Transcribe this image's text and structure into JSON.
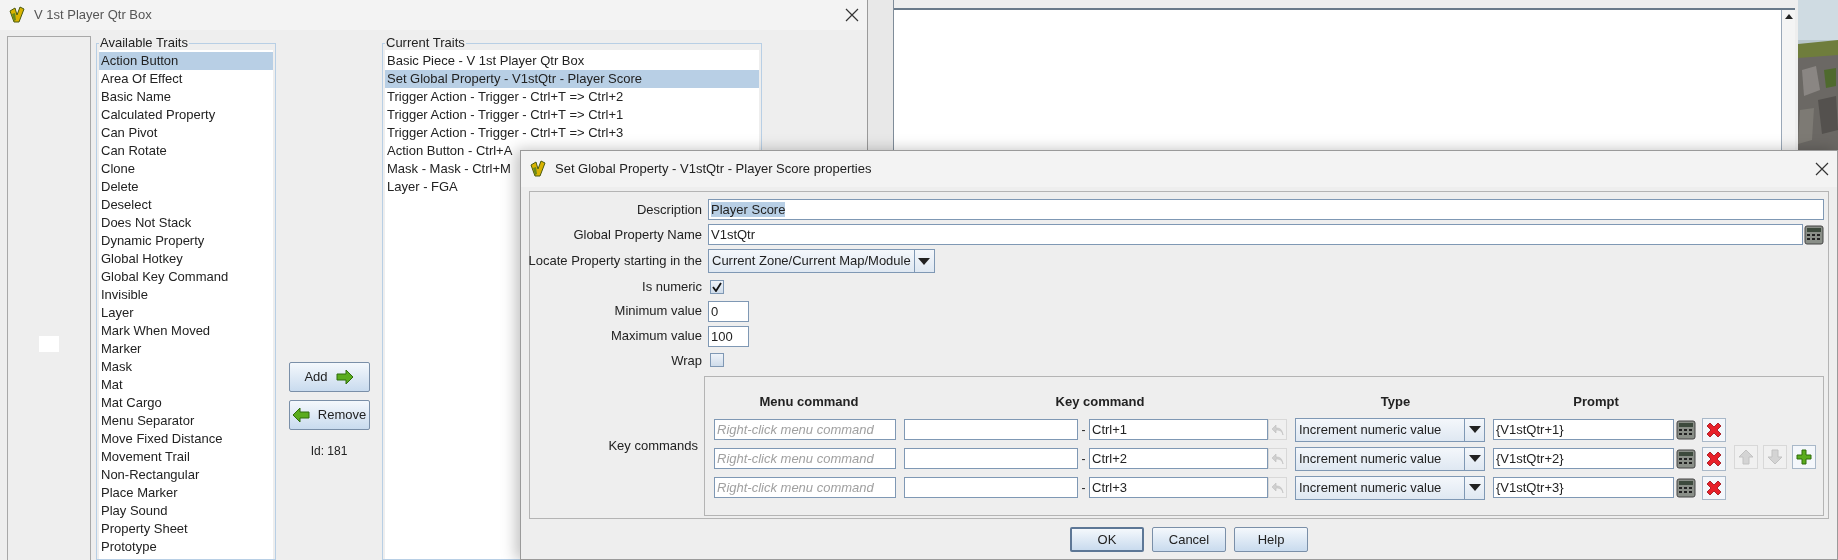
{
  "main_window": {
    "title": "V 1st Player Qtr Box"
  },
  "available_traits": {
    "title": "Available Traits",
    "items": [
      {
        "label": "Action Button",
        "selected": true
      },
      {
        "label": "Area Of Effect",
        "selected": false
      },
      {
        "label": "Basic Name",
        "selected": false
      },
      {
        "label": "Calculated Property",
        "selected": false
      },
      {
        "label": "Can Pivot",
        "selected": false
      },
      {
        "label": "Can Rotate",
        "selected": false
      },
      {
        "label": "Clone",
        "selected": false
      },
      {
        "label": "Delete",
        "selected": false
      },
      {
        "label": "Deselect",
        "selected": false
      },
      {
        "label": "Does Not Stack",
        "selected": false
      },
      {
        "label": "Dynamic Property",
        "selected": false
      },
      {
        "label": "Global Hotkey",
        "selected": false
      },
      {
        "label": "Global Key Command",
        "selected": false
      },
      {
        "label": "Invisible",
        "selected": false
      },
      {
        "label": "Layer",
        "selected": false
      },
      {
        "label": "Mark When Moved",
        "selected": false
      },
      {
        "label": "Marker",
        "selected": false
      },
      {
        "label": "Mask",
        "selected": false
      },
      {
        "label": "Mat",
        "selected": false
      },
      {
        "label": "Mat Cargo",
        "selected": false
      },
      {
        "label": "Menu Separator",
        "selected": false
      },
      {
        "label": "Move Fixed Distance",
        "selected": false
      },
      {
        "label": "Movement Trail",
        "selected": false
      },
      {
        "label": "Non-Rectangular",
        "selected": false
      },
      {
        "label": "Place Marker",
        "selected": false
      },
      {
        "label": "Play Sound",
        "selected": false
      },
      {
        "label": "Property Sheet",
        "selected": false
      },
      {
        "label": "Prototype",
        "selected": false
      }
    ]
  },
  "trait_buttons": [
    {
      "kind": "add",
      "label": "Add"
    },
    {
      "kind": "remove",
      "label": "Remove"
    }
  ],
  "id_label": "Id: 181",
  "current_traits": {
    "title": "Current Traits",
    "items": [
      {
        "label": "Basic Piece - V 1st Player Qtr Box",
        "selected": false
      },
      {
        "label": "Set Global Property - V1stQtr - Player Score",
        "selected": true
      },
      {
        "label": "Trigger Action - Trigger - Ctrl+T => Ctrl+2",
        "selected": false
      },
      {
        "label": "Trigger Action - Trigger - Ctrl+T => Ctrl+1",
        "selected": false
      },
      {
        "label": "Trigger Action - Trigger - Ctrl+T => Ctrl+3",
        "selected": false
      },
      {
        "label": "Action Button - Ctrl+A",
        "selected": false
      },
      {
        "label": "Mask - Mask - Ctrl+M",
        "selected": false
      },
      {
        "label": "Layer - FGA",
        "selected": false
      }
    ]
  },
  "dialog": {
    "title": "Set Global Property - V1stQtr - Player Score properties",
    "form": [
      {
        "kind": "text",
        "label": "Description",
        "value": "Player Score",
        "text_selected": true,
        "calculator": false
      },
      {
        "kind": "text",
        "label": "Global Property Name",
        "value": "V1stQtr",
        "text_selected": false,
        "calculator": true
      },
      {
        "kind": "combo",
        "label": "Locate Property starting in the",
        "value": "Current Zone/Current Map/Module"
      },
      {
        "kind": "checkbox",
        "label": "Is numeric",
        "checked": true
      },
      {
        "kind": "short_text",
        "label": "Minimum value",
        "value": "0"
      },
      {
        "kind": "short_text",
        "label": "Maximum value",
        "value": "100"
      },
      {
        "kind": "checkbox",
        "label": "Wrap",
        "checked": false
      }
    ],
    "key_commands": {
      "label": "Key commands",
      "columns": [
        "Menu command",
        "Key command",
        "Type",
        "Prompt"
      ],
      "rows": [
        {
          "menu_placeholder": "Right-click menu command",
          "separator": "-",
          "keystroke": "Ctrl+1",
          "type": "Increment numeric value",
          "prompt": "{V1stQtr+1}"
        },
        {
          "menu_placeholder": "Right-click menu command",
          "separator": "-",
          "keystroke": "Ctrl+2",
          "type": "Increment numeric value",
          "prompt": "{V1stQtr+2}"
        },
        {
          "menu_placeholder": "Right-click menu command",
          "separator": "-",
          "keystroke": "Ctrl+3",
          "type": "Increment numeric value",
          "prompt": "{V1stQtr+3}"
        }
      ],
      "side_buttons": [
        {
          "kind": "up",
          "disabled": true
        },
        {
          "kind": "down",
          "disabled": true
        },
        {
          "kind": "add",
          "disabled": false
        }
      ]
    },
    "buttons": [
      {
        "label": "OK",
        "focused": true
      },
      {
        "label": "Cancel",
        "focused": false
      },
      {
        "label": "Help",
        "focused": false
      }
    ]
  }
}
